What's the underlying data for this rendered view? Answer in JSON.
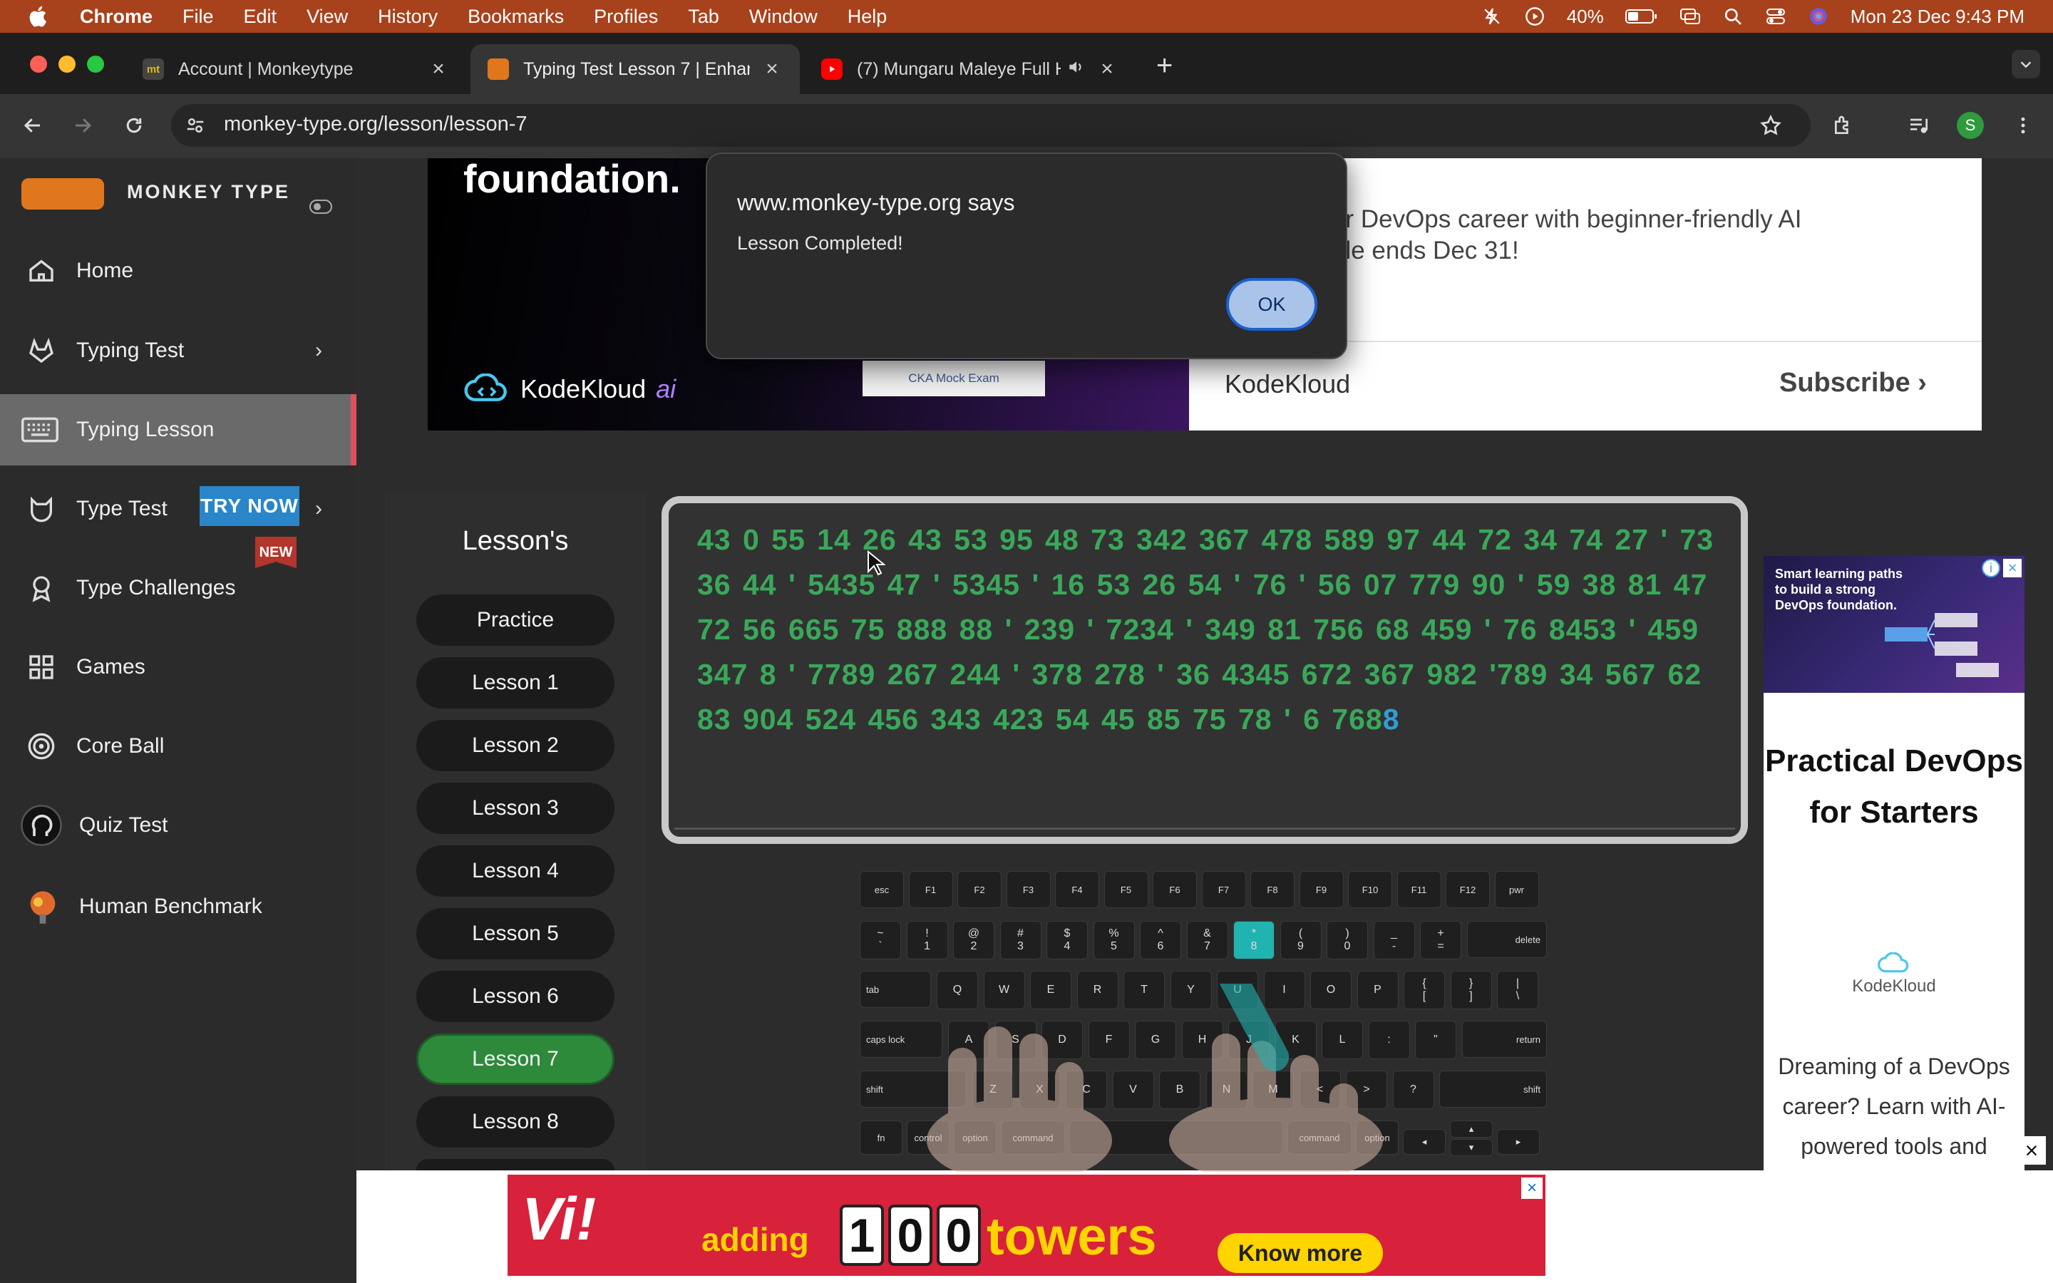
{
  "menubar": {
    "app": "Chrome",
    "items": [
      "File",
      "Edit",
      "View",
      "History",
      "Bookmarks",
      "Profiles",
      "Tab",
      "Window",
      "Help"
    ],
    "battery": "40%",
    "datetime": "Mon 23 Dec  9:43 PM"
  },
  "tabs": [
    {
      "favicon": "mt",
      "title": "Account | Monkeytype"
    },
    {
      "favicon": "",
      "title": "Typing Test Lesson 7 | Enhanc"
    },
    {
      "favicon": "",
      "title": "(7) Mungaru Maleye Full H"
    }
  ],
  "address": {
    "url": "monkey-type.org/lesson/lesson-7",
    "profile_initial": "S"
  },
  "sidebar": {
    "brand": "MONKEY TYPE",
    "items": [
      {
        "label": "Home",
        "icon": "home-icon"
      },
      {
        "label": "Typing Test",
        "icon": "gitlab-icon"
      },
      {
        "label": "Typing Lesson",
        "icon": "keyboard-icon"
      },
      {
        "label": "Type Test",
        "icon": "cat-icon",
        "badge": "TRY NOW"
      },
      {
        "label": "Type Challenges",
        "icon": "award-icon",
        "badge": "NEW"
      },
      {
        "label": "Games",
        "icon": "grid-icon"
      },
      {
        "label": "Core Ball",
        "icon": "target-icon"
      },
      {
        "label": "Quiz Test",
        "icon": "head-icon"
      },
      {
        "label": "Human Benchmark",
        "icon": "brain-icon"
      }
    ]
  },
  "top_ad": {
    "headline": "foundation.",
    "brand": "KodeKloud",
    "brand_suffix": "ai",
    "cka": "CKA Mock Exam",
    "copy_line1": "ur DevOps career with beginner-friendly AI",
    "copy_line2": "ale ends Dec 31!",
    "brand2": "KodeKloud",
    "subscribe": "Subscribe"
  },
  "dialog": {
    "title": "www.monkey-type.org says",
    "message": "Lesson Completed!",
    "ok": "OK"
  },
  "lessons": {
    "title": "Lesson's",
    "items": [
      "Practice",
      "Lesson 1",
      "Lesson 2",
      "Lesson 3",
      "Lesson 4",
      "Lesson 5",
      "Lesson 6",
      "Lesson 7",
      "Lesson 8"
    ],
    "active": "Lesson 7"
  },
  "typing": {
    "typed": "43 0 55 14 26 43 53 95 48 73 342 367 478 589 97 44 72 34 74 27 ' 73 36 44 ' 5435 47 ' 5345 ' 16 53 26 54 ' 76 ' 56 07 779 90 ' 59 38 81 47 72 56 665 75 888 88 ' 239 ' 7234 ' 349 81 756 68 459 ' 76 8453 ' 459 347 8 ' 7789 267 244 ' 378 278 ' 36 4345 672 367 982 '789 34 567 62 83 904 524 456 343 423 54 45 85 75 78 ' 6 768",
    "current": "8"
  },
  "keyboard": {
    "row0": [
      "esc",
      "F1",
      "F2",
      "F3",
      "F4",
      "F5",
      "F6",
      "F7",
      "F8",
      "F9",
      "F10",
      "F11",
      "F12",
      "pwr"
    ],
    "row1_top": [
      "~",
      "!",
      "@",
      "#",
      "$",
      "%",
      "^",
      "&",
      "*",
      "(",
      ")",
      "_",
      "+"
    ],
    "row1_bot": [
      "`",
      "1",
      "2",
      "3",
      "4",
      "5",
      "6",
      "7",
      "8",
      "9",
      "0",
      "-",
      "="
    ],
    "delete": "delete",
    "tab": "tab",
    "row2": [
      "Q",
      "W",
      "E",
      "R",
      "T",
      "Y",
      "U",
      "I",
      "O",
      "P"
    ],
    "row2_sym_top": [
      "{",
      "}",
      "|"
    ],
    "row2_sym_bot": [
      "[",
      "]",
      "\\"
    ],
    "caps": "caps lock",
    "row3": [
      "A",
      "S",
      "D",
      "F",
      "G",
      "H",
      "J",
      "K",
      "L"
    ],
    "row3_sym": [
      ":",
      "\""
    ],
    "return": "return",
    "shift": "shift",
    "row4": [
      "Z",
      "X",
      "C",
      "V",
      "B",
      "N",
      "M"
    ],
    "row4_sym": [
      "<",
      ">",
      "?"
    ],
    "fn": "fn",
    "control": "control",
    "option": "option",
    "command": "command",
    "highlight": "8"
  },
  "right_ad": {
    "banner": "Smart learning paths to build a strong DevOps foundation.",
    "title": "Practical DevOps for Starters",
    "brand": "KodeKloud",
    "desc": "Dreaming of a DevOps career? Learn with AI-powered tools and"
  },
  "bottom_ad": {
    "logo": "Vi!",
    "adding": "adding",
    "number": [
      "1",
      "0",
      "0"
    ],
    "towers": "towers",
    "cta": "Know more"
  },
  "colors": {
    "menubar": "#a8421c",
    "typed_text": "#3aa85a",
    "cursor": "#2f9dd6",
    "active_lesson": "#2c8a3a",
    "active_nav_accent": "#e0505a"
  }
}
